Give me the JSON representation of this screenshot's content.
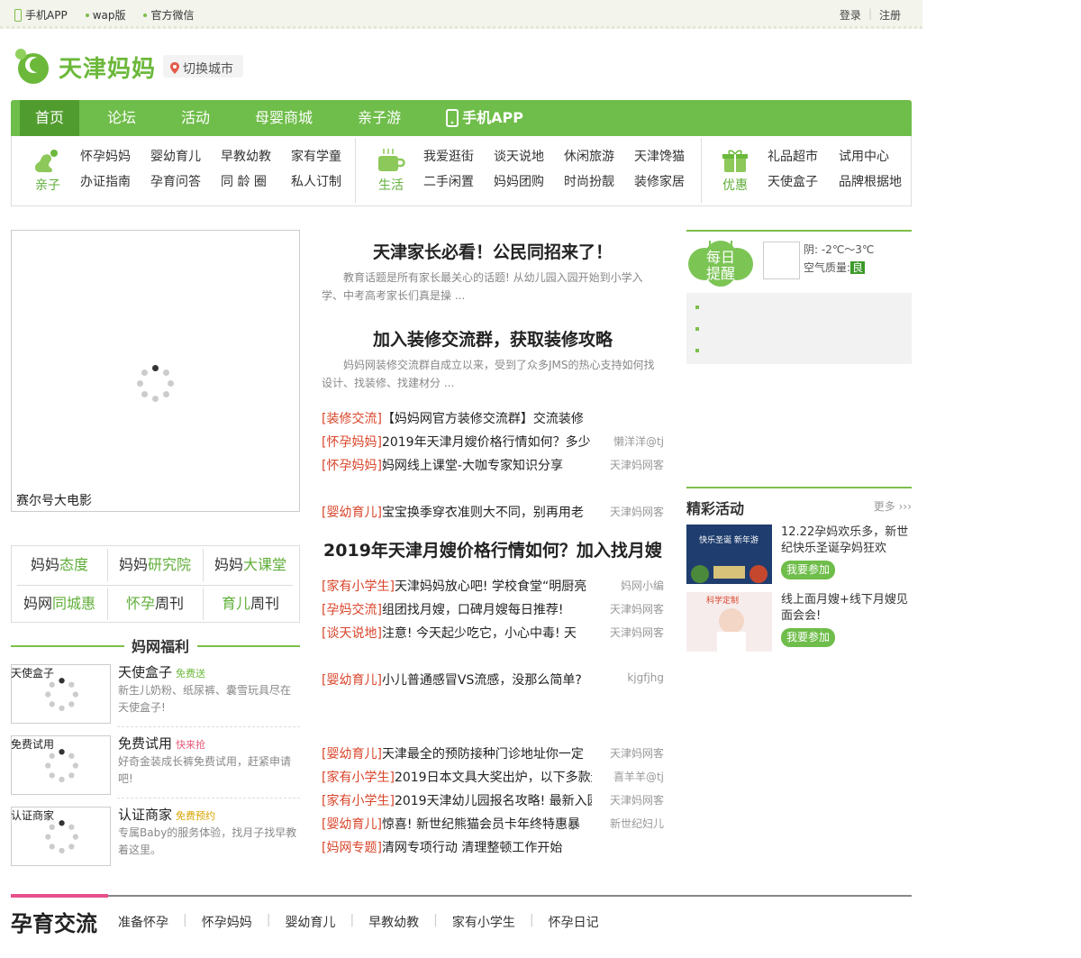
{
  "topbar": {
    "app": "手机APP",
    "wap": "wap版",
    "wechat": "官方微信",
    "login": "登录",
    "register": "注册"
  },
  "header": {
    "logo": "天津妈妈",
    "city": "切换城市"
  },
  "nav": {
    "items": [
      "首页",
      "论坛",
      "活动",
      "母婴商城",
      "亲子游",
      "手机APP"
    ]
  },
  "subnav": {
    "g1": {
      "label": "亲子",
      "links": [
        "怀孕妈妈",
        "婴幼育儿",
        "早教幼教",
        "家有学童",
        "办证指南",
        "孕育问答",
        "同 龄 圈",
        "私人订制"
      ]
    },
    "g2": {
      "label": "生活",
      "links": [
        "我爱逛街",
        "谈天说地",
        "休闲旅游",
        "天津馋猫",
        "二手闲置",
        "妈妈团购",
        "时尚扮靓",
        "装修家居"
      ]
    },
    "g3": {
      "label": "优惠",
      "links": [
        "礼品超市",
        "试用中心",
        "天使盒子",
        "品牌根据地"
      ]
    }
  },
  "video": {
    "caption": "赛尔号大电影"
  },
  "quick_links": [
    {
      "a": "妈妈",
      "b": "态度"
    },
    {
      "a": "妈妈",
      "b": "研究院"
    },
    {
      "a": "妈妈",
      "b": "大课堂"
    },
    {
      "a": "妈网",
      "b": "同城惠"
    },
    {
      "a": "怀孕",
      "b": "周刊"
    },
    {
      "a": "育儿",
      "b": "周刊"
    }
  ],
  "welfare": {
    "title": "妈网福利",
    "items": [
      {
        "thumb": "天使盒子",
        "title": "天使盒子",
        "tag": "免费送",
        "desc": "新生儿奶粉、纸尿裤、囊雪玩具尽在天使盒子!"
      },
      {
        "thumb": "免费试用",
        "title": "免费试用",
        "tag": "快来抢",
        "desc": "好奇金装成长裤免费试用，赶紧申请吧!"
      },
      {
        "thumb": "认证商家",
        "title": "认证商家",
        "tag": "免费预约",
        "desc": "专属Baby的服务体验，找月子找早教着这里。"
      }
    ]
  },
  "middle": {
    "h1": "天津家长必看！公民同招来了！",
    "s1": "教育话题是所有家长最关心的话题! 从幼儿园入园开始到小学入学、中考高考家长们真是操 ...",
    "h2": "加入装修交流群，获取装修攻略",
    "s2": "妈妈网装修交流群自成立以来，受到了众多JMS的热心支持如何找设计、找装修、找建材分 ...",
    "rows1": [
      {
        "cat": "[装修交流]",
        "text": "【妈妈网官方装修交流群】交流装修",
        "author": ""
      },
      {
        "cat": "[怀孕妈妈]",
        "text": "2019年天津月嫂价格行情如何？多少",
        "author": "懒洋洋@tj"
      },
      {
        "cat": "[怀孕妈妈]",
        "text": "妈网线上课堂-大咖专家知识分享",
        "author": "天津妈网客"
      }
    ],
    "row_single": {
      "cat": "[婴幼育儿]",
      "text": "宝宝换季穿衣准则大不同，别再用老",
      "author": "天津妈网客"
    },
    "h3": "2019年天津月嫂价格行情如何？加入找月嫂",
    "rows2": [
      {
        "cat": "[家有小学生]",
        "text": "天津妈妈放心吧! 学校食堂“明厨亮",
        "author": "妈网小编"
      },
      {
        "cat": "[孕妈交流]",
        "text": "组团找月嫂，口碑月嫂每日推荐!",
        "author": "天津妈网客"
      },
      {
        "cat": "[谈天说地]",
        "text": "注意! 今天起少吃它，小心中毒! 天",
        "author": "天津妈网客"
      }
    ],
    "row_single2": {
      "cat": "[婴幼育儿]",
      "text": "小儿普通感冒VS流感，没那么简单?",
      "author": "kjgfjhg"
    },
    "rows3": [
      {
        "cat": "[婴幼育儿]",
        "text": "天津最全的预防接种门诊地址你一定",
        "author": "天津妈网客"
      },
      {
        "cat": "[家有小学生]",
        "text": "2019日本文具大奖出炉，以下多款适",
        "author": "喜羊羊@tj"
      },
      {
        "cat": "[家有小学生]",
        "text": "2019天津幼儿园报名攻略! 最新入园",
        "author": "天津妈网客"
      },
      {
        "cat": "[婴幼育儿]",
        "text": "惊喜! 新世纪熊猫会员卡年终特惠暴",
        "author": "新世纪妇儿"
      },
      {
        "cat": "[妈网专题]",
        "text": "清网专项行动 清理整顿工作开始",
        "author": ""
      }
    ]
  },
  "weather": {
    "badge": "每日提醒",
    "line1": "阴: -2℃～3℃",
    "aq_label": "空气质量:",
    "aq_value": "良"
  },
  "activities": {
    "title": "精彩活动",
    "more": "更多",
    "items": [
      {
        "text": "12.22孕妈欢乐多，新世纪快乐圣诞孕妈狂欢",
        "btn": "我要参加",
        "img": "快乐圣诞 新年游"
      },
      {
        "text": "线上面月嫂+线下月嫂见面会会!",
        "btn": "我要参加",
        "img": "科学定制"
      }
    ]
  },
  "bottom": {
    "title": "孕育交流",
    "tabs": [
      "准备怀孕",
      "怀孕妈妈",
      "婴幼育儿",
      "早教幼教",
      "家有小学生",
      "怀孕日记"
    ]
  }
}
